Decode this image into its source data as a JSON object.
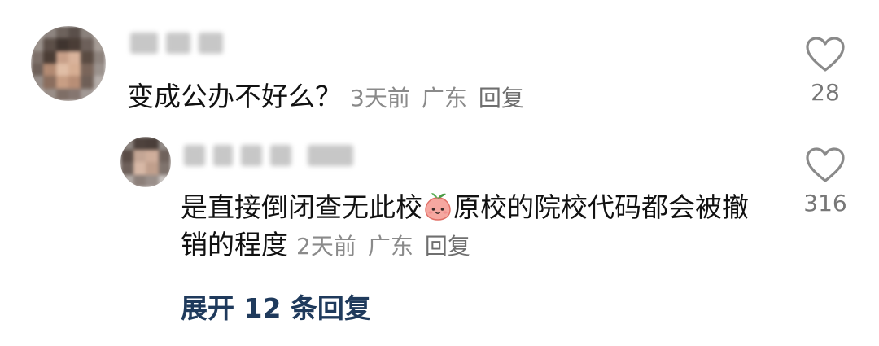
{
  "comment": {
    "text": "变成公办不好么？",
    "time": "3天前",
    "location": "广东",
    "reply_label": "回复",
    "likes": "28",
    "like_icon": "heart-outline-icon"
  },
  "reply": {
    "text_before_emoji": "是直接倒闭查无此校",
    "emoji": "peach-face-emoji",
    "text_after_emoji": "原校的院校代码都会被撤销的程度",
    "time": "2天前",
    "location": "广东",
    "reply_label": "回复",
    "likes": "316",
    "like_icon": "heart-outline-icon"
  },
  "expand_replies": {
    "label": "展开 12 条回复",
    "color": "#1f3a5c"
  }
}
